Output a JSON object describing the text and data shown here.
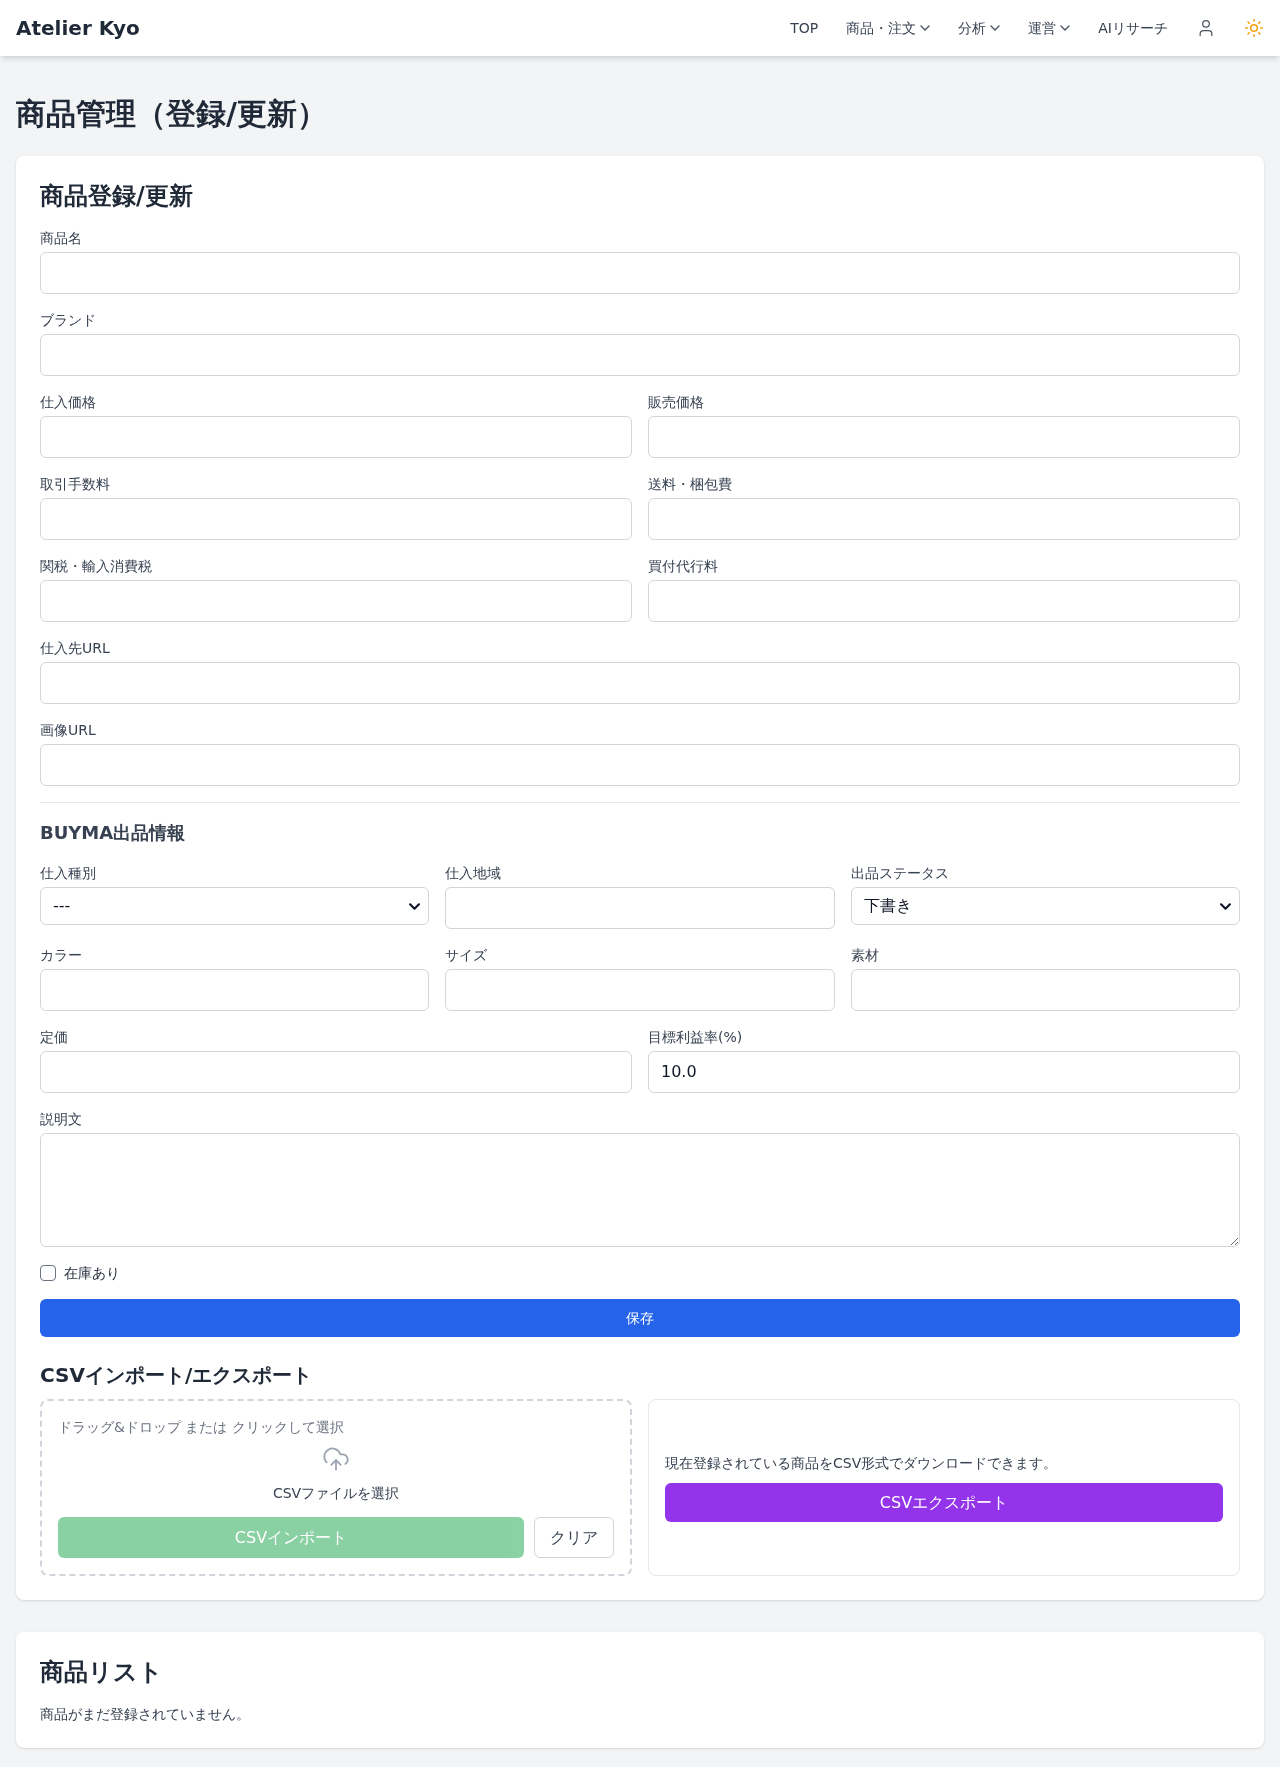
{
  "header": {
    "logo": "Atelier Kyo",
    "nav": [
      {
        "label": "TOP",
        "has_menu": false
      },
      {
        "label": "商品・注文",
        "has_menu": true
      },
      {
        "label": "分析",
        "has_menu": true
      },
      {
        "label": "運営",
        "has_menu": true
      },
      {
        "label": "AIリサーチ",
        "has_menu": false
      }
    ]
  },
  "page_title": "商品管理（登録/更新）",
  "form": {
    "title": "商品登録/更新",
    "rows": [
      {
        "fields": [
          {
            "label": "商品名",
            "kind": "input"
          }
        ]
      },
      {
        "fields": [
          {
            "label": "ブランド",
            "kind": "input"
          }
        ]
      },
      {
        "fields": [
          {
            "label": "仕入価格",
            "kind": "input"
          },
          {
            "label": "販売価格",
            "kind": "input"
          }
        ]
      },
      {
        "fields": [
          {
            "label": "取引手数料",
            "kind": "input"
          },
          {
            "label": "送料・梱包費",
            "kind": "input"
          }
        ]
      },
      {
        "fields": [
          {
            "label": "関税・輸入消費税",
            "kind": "input"
          },
          {
            "label": "買付代行料",
            "kind": "input"
          }
        ]
      },
      {
        "fields": [
          {
            "label": "仕入先URL",
            "kind": "input"
          }
        ]
      },
      {
        "fields": [
          {
            "label": "画像URL",
            "kind": "input"
          }
        ]
      }
    ],
    "section": {
      "title": "BUYMA出品情報",
      "rows": [
        {
          "fields": [
            {
              "label": "仕入種別",
              "kind": "select",
              "value": "---"
            },
            {
              "label": "仕入地域",
              "kind": "input"
            },
            {
              "label": "出品ステータス",
              "kind": "select",
              "value": "下書き"
            }
          ]
        },
        {
          "fields": [
            {
              "label": "カラー",
              "kind": "input"
            },
            {
              "label": "サイズ",
              "kind": "input"
            },
            {
              "label": "素材",
              "kind": "input"
            }
          ]
        },
        {
          "fields": [
            {
              "label": "定価",
              "kind": "input"
            },
            {
              "label": "目標利益率(%)",
              "kind": "input",
              "value": "10.0"
            }
          ]
        },
        {
          "fields": [
            {
              "label": "説明文",
              "kind": "textarea"
            }
          ]
        }
      ]
    },
    "stock_checkbox": {
      "label": "在庫あり",
      "checked": false
    },
    "save_button": "保存",
    "csv": {
      "title": "CSVインポート/エクスポート",
      "import": {
        "hint": "ドラッグ&ドロップ または クリックして選択",
        "file_label": "CSVファイルを選択",
        "import_button": {
          "label": "CSVインポート",
          "disabled": true
        },
        "clear_button": "クリア"
      },
      "export": {
        "description": "現在登録されている商品をCSV形式でダウンロードできます。",
        "button": "CSVエクスポート"
      }
    }
  },
  "product_list": {
    "title": "商品リスト",
    "empty_message": "商品がまだ登録されていません。"
  }
}
